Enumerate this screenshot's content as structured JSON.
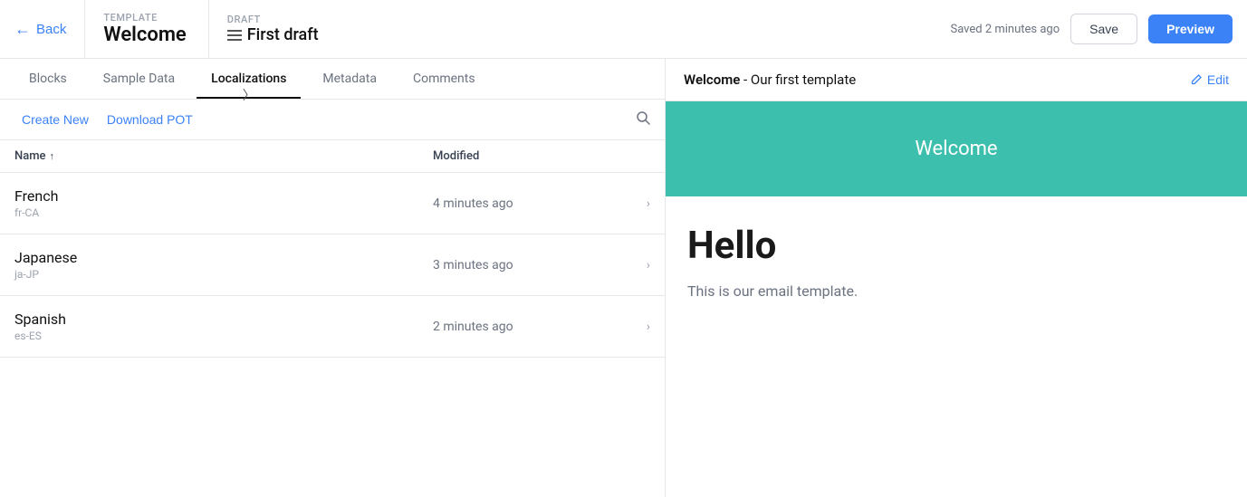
{
  "header": {
    "back_label": "Back",
    "template_label": "TEMPLATE",
    "template_name": "Welcome",
    "draft_label": "DRAFT",
    "draft_name": "First draft",
    "saved_text": "Saved 2 minutes ago",
    "save_label": "Save",
    "preview_label": "Preview"
  },
  "tabs": [
    {
      "id": "blocks",
      "label": "Blocks",
      "active": false
    },
    {
      "id": "sample-data",
      "label": "Sample Data",
      "active": false
    },
    {
      "id": "localizations",
      "label": "Localizations",
      "active": true
    },
    {
      "id": "metadata",
      "label": "Metadata",
      "active": false
    },
    {
      "id": "comments",
      "label": "Comments",
      "active": false
    }
  ],
  "toolbar": {
    "create_new_label": "Create New",
    "download_pot_label": "Download POT"
  },
  "table": {
    "col_name": "Name",
    "col_modified": "Modified",
    "rows": [
      {
        "name": "French",
        "code": "fr-CA",
        "modified": "4 minutes ago"
      },
      {
        "name": "Japanese",
        "code": "ja-JP",
        "modified": "3 minutes ago"
      },
      {
        "name": "Spanish",
        "code": "es-ES",
        "modified": "2 minutes ago"
      }
    ]
  },
  "preview": {
    "title_bold": "Welcome",
    "title_rest": " - Our first template",
    "edit_label": "Edit",
    "hero_text": "Welcome",
    "email_heading": "Hello",
    "email_body": "This is our email template."
  }
}
